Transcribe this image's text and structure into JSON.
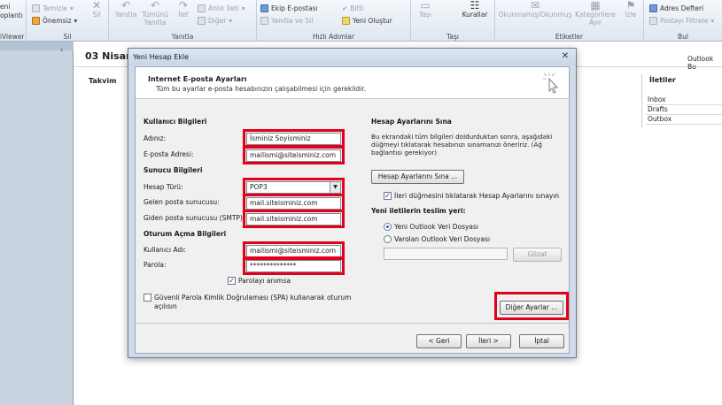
{
  "ribbon": {
    "viewer_label": "iViewer",
    "new_label": "eni",
    "new_label2": "oplantı",
    "delete_group": {
      "clean_label": "Temizle",
      "junk_label": "Önemsiz",
      "delete_label": "Sil",
      "group_label": "Sil"
    },
    "respond_group": {
      "reply_label": "Yanıtla",
      "reply_all_label": "Tümünü Yanıtla",
      "forward_label": "İlet",
      "im_label": "Anlık İleti",
      "more_label": "Diğer",
      "group_label": "Yanıtla"
    },
    "quicksteps_group": {
      "team_email": "Ekip E-postası",
      "reply_delete": "Yanıtla ve Sil",
      "done": "Bitti",
      "create_new": "Yeni Oluştur",
      "group_label": "Hızlı Adımlar"
    },
    "move_group": {
      "move_label": "Taşı",
      "rules_label": "Kurallar",
      "group_label": "Taşı"
    },
    "tags_group": {
      "unread_label": "Okunmamış/Okunmuş",
      "categorize_label": "Kategorilere Ayır",
      "follow_label": "İzle",
      "group_label": "Etiketler"
    },
    "find_group": {
      "address_book": "Adres Defteri",
      "filter_email": "Postayı Filtrele",
      "group_label": "Bul"
    }
  },
  "background": {
    "date_title": "03 Nisan",
    "app_name": "Outlook Bu",
    "calendar_label": "Takvim",
    "folders": {
      "title": "İletiler",
      "items": [
        "Inbox",
        "Drafts",
        "Outbox"
      ]
    }
  },
  "dialog": {
    "title": "Yeni Hesap Ekle",
    "header_title": "Internet E-posta Ayarları",
    "header_subtitle": "Tüm bu ayarlar e-posta hesabınızın çalışabilmesi için gereklidir.",
    "user_info": {
      "title": "Kullanıcı Bilgileri",
      "name_label": "Adınız:",
      "name_value": "İsminiz Soyisminiz",
      "email_label": "E-posta Adresi:",
      "email_value": "mailismi@siteisminiz.com"
    },
    "server_info": {
      "title": "Sunucu Bilgileri",
      "account_type_label": "Hesap Türü:",
      "account_type_value": "POP3",
      "incoming_label": "Gelen posta sunucusu:",
      "incoming_value": "mail.siteisminiz.com",
      "outgoing_label": "Giden posta sunucusu (SMTP):",
      "outgoing_value": "mail.siteisminiz.com"
    },
    "logon_info": {
      "title": "Oturum Açma Bilgileri",
      "username_label": "Kullanıcı Adı:",
      "username_value": "mailismi@siteisminiz.com",
      "password_label": "Parola:",
      "password_value": "**************",
      "remember_label": "Parolayı anımsa",
      "spa_label_line1": "Güvenli Parola Kimlik Doğrulaması (SPA) kullanarak oturum",
      "spa_label_line2": "açılısın"
    },
    "test": {
      "title": "Hesap Ayarlarını Sına",
      "desc_line1": "Bu ekrandaki tüm bilgileri doldurduktan sonra, aşağıdaki",
      "desc_line2": "düğmeyi tıklatarak hesabınızı sınamanızı öneririz. (Ağ",
      "desc_line3": "bağlantısı gerekiyor)",
      "test_button": "Hesap Ayarlarını Sına ...",
      "auto_test_label": "İleri düğmesini tıklatarak Hesap Ayarlarını sınayın"
    },
    "delivery": {
      "title": "Yeni iletilerin teslim yeri:",
      "new_file_label": "Yeni Outlook Veri Dosyası",
      "existing_file_label": "Varolan Outlook Veri Dosyası",
      "existing_path_value": "",
      "browse_button": "Gözat"
    },
    "more_settings_button": "Diğer Ayarlar ...",
    "back_button": "< Geri",
    "next_button": "İleri >",
    "cancel_button": "İptal"
  },
  "colors": {
    "highlight_red": "#e3001b",
    "ribbon_bg": "#dfe7f1",
    "dialog_frame": "#cfdbe9"
  }
}
